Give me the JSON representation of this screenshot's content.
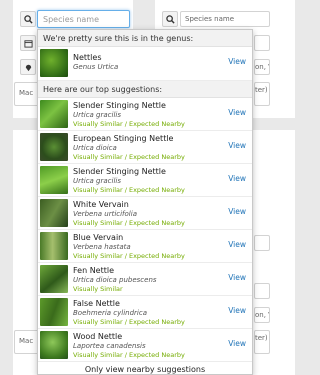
{
  "search": {
    "placeholder": "Species name",
    "bg_placeholder": "Species name"
  },
  "background": {
    "place_text_1": "on, V",
    "place_text_2": "on, V",
    "card1_text": "Mac",
    "card1_right": "ter)",
    "card2_text": "Mac",
    "card2_right": "ter)"
  },
  "dropdown": {
    "genus_header": "We're pretty sure this is in the genus:",
    "genus": {
      "name": "Nettles",
      "sci": "Genus Urtica",
      "view": "View"
    },
    "suggestions_header": "Here are our top suggestions:",
    "suggestions": [
      {
        "name": "Slender Stinging Nettle",
        "sci": "Urtica gracilis",
        "tag": "Visually Similar / Expected Nearby",
        "view": "View"
      },
      {
        "name": "European Stinging Nettle",
        "sci": "Urtica dioica",
        "tag": "Visually Similar / Expected Nearby",
        "view": "View"
      },
      {
        "name": "Slender Stinging Nettle",
        "sci": "Urtica gracilis",
        "tag": "Visually Similar / Expected Nearby",
        "view": "View"
      },
      {
        "name": "White Vervain",
        "sci": "Verbena urticifolia",
        "tag": "Visually Similar / Expected Nearby",
        "view": "View"
      },
      {
        "name": "Blue Vervain",
        "sci": "Verbena hastata",
        "tag": "Visually Similar / Expected Nearby",
        "view": "View"
      },
      {
        "name": "Fen Nettle",
        "sci": "Urtica dioica pubescens",
        "tag": "Visually Similar",
        "view": "View"
      },
      {
        "name": "False Nettle",
        "sci": "Boehmeria cylindrica",
        "tag": "Visually Similar / Expected Nearby",
        "view": "View"
      },
      {
        "name": "Wood Nettle",
        "sci": "Laportea canadensis",
        "tag": "Visually Similar / Expected Nearby",
        "view": "View"
      }
    ],
    "footer": "Only view nearby suggestions"
  },
  "colors": {
    "tag_green": "#74ac00",
    "link_blue": "#1f73b7",
    "focus_blue": "#66afe9"
  }
}
